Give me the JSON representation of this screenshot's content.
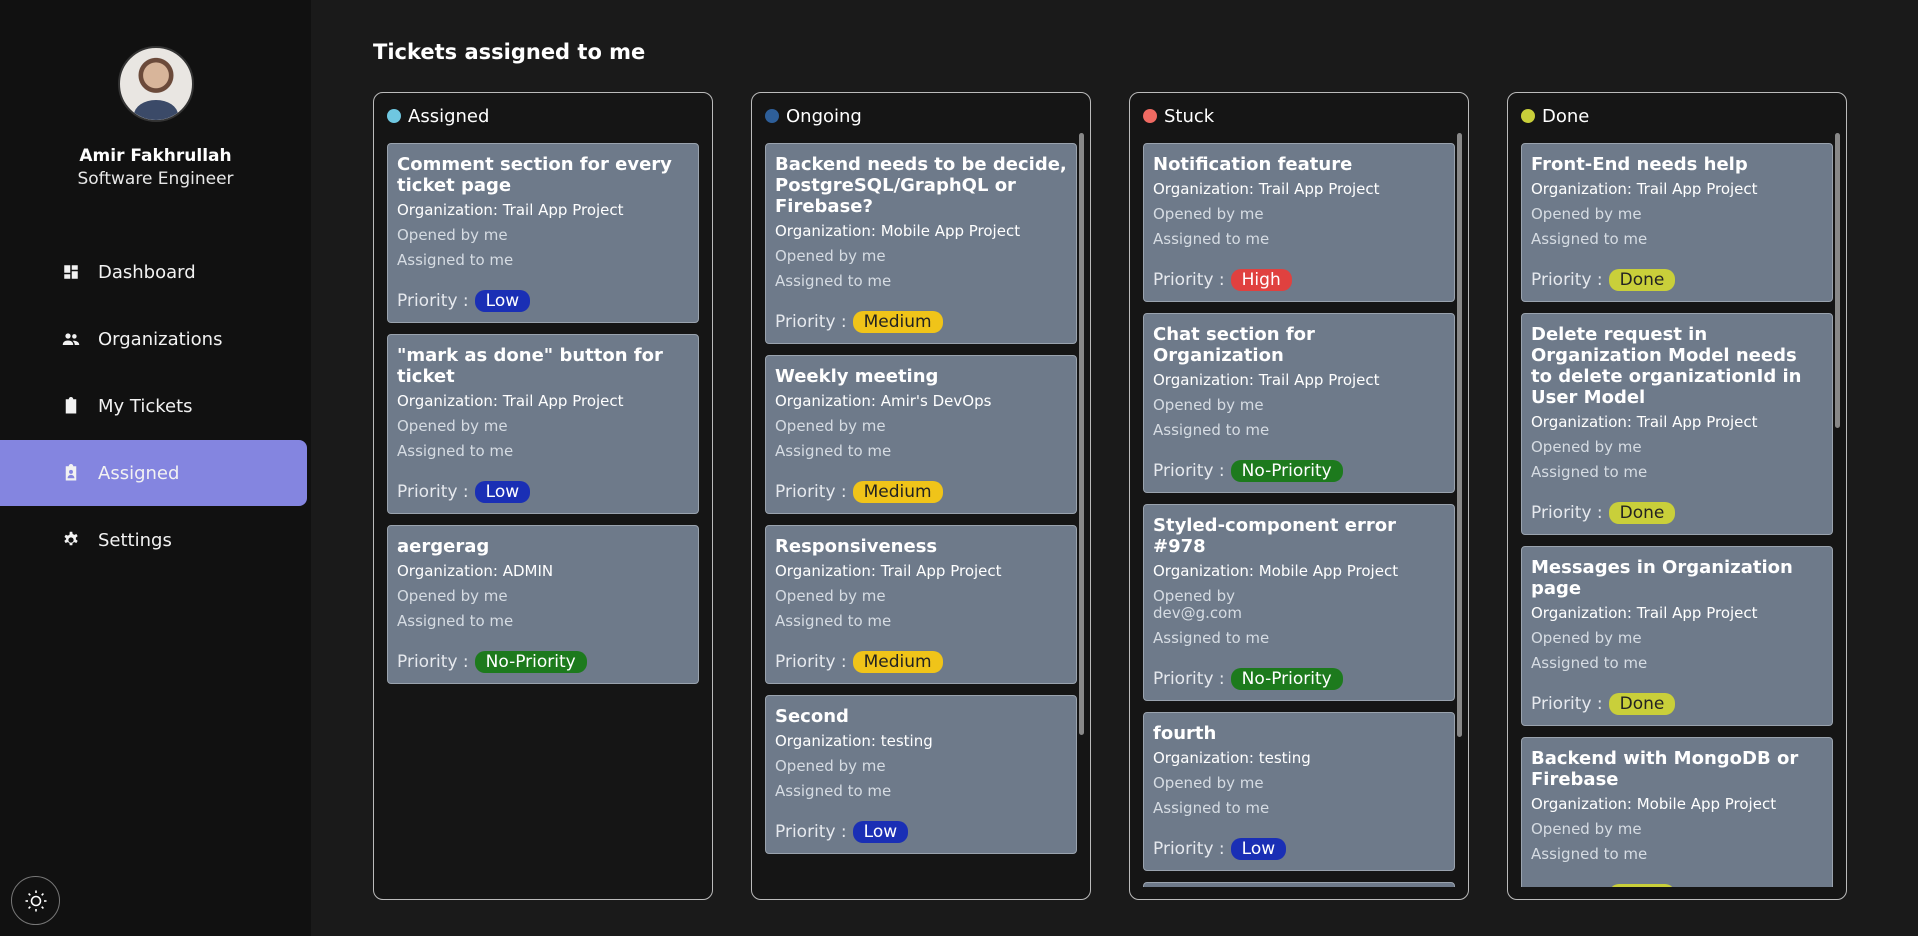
{
  "user": {
    "name": "Amir Fakhrullah",
    "role": "Software Engineer"
  },
  "nav": [
    {
      "label": "Dashboard",
      "icon": "dashboard-icon",
      "active": false
    },
    {
      "label": "Organizations",
      "icon": "people-icon",
      "active": false
    },
    {
      "label": "My Tickets",
      "icon": "clipboard-icon",
      "active": false
    },
    {
      "label": "Assigned",
      "icon": "assigned-clipboard-icon",
      "active": true
    },
    {
      "label": "Settings",
      "icon": "gear-icon",
      "active": false
    }
  ],
  "page_title": "Tickets assigned to me",
  "priority_label": "Priority :",
  "colors": {
    "Low": "#1a2fb5",
    "Medium": "#f0c419",
    "High": "#e0413f",
    "No-Priority": "#1d7a1d",
    "Done": "#c9cf3a"
  },
  "columns": [
    {
      "name": "Assigned",
      "dot": "#6fc7e0",
      "cards": [
        {
          "title": "Comment section for every ticket page",
          "org": "Organization: Trail App Project",
          "opened": "Opened by me",
          "assigned": "Assigned to me",
          "priority": "Low"
        },
        {
          "title": "\"mark as done\" button for ticket",
          "org": "Organization: Trail App Project",
          "opened": "Opened by me",
          "assigned": "Assigned to me",
          "priority": "Low"
        },
        {
          "title": "aergerag",
          "org": "Organization: ADMIN",
          "opened": "Opened by me",
          "assigned": "Assigned to me",
          "priority": "No-Priority"
        }
      ]
    },
    {
      "name": "Ongoing",
      "dot": "#2e5f9a",
      "cards": [
        {
          "title": "Backend needs to be decide, PostgreSQL/GraphQL or Firebase?",
          "org": "Organization: Mobile App Project",
          "opened": "Opened by me",
          "assigned": "Assigned to me",
          "priority": "Medium"
        },
        {
          "title": "Weekly meeting",
          "org": "Organization: Amir's DevOps",
          "opened": "Opened by me",
          "assigned": "Assigned to me",
          "priority": "Medium"
        },
        {
          "title": "Responsiveness",
          "org": "Organization: Trail App Project",
          "opened": "Opened by me",
          "assigned": "Assigned to me",
          "priority": "Medium"
        },
        {
          "title": "Second",
          "org": "Organization: testing",
          "opened": "Opened by me",
          "assigned": "Assigned to me",
          "priority": "Low"
        }
      ]
    },
    {
      "name": "Stuck",
      "dot": "#ef6a62",
      "cards": [
        {
          "title": "Notification feature",
          "org": "Organization: Trail App Project",
          "opened": "Opened by me",
          "assigned": "Assigned to me",
          "priority": "High"
        },
        {
          "title": "Chat section for Organization",
          "org": "Organization: Trail App Project",
          "opened": "Opened by me",
          "assigned": "Assigned to me",
          "priority": "No-Priority"
        },
        {
          "title": "Styled-component error #978",
          "org": "Organization: Mobile App Project",
          "opened": "Opened by\ndev@g.com",
          "assigned": "Assigned to me",
          "priority": "No-Priority"
        },
        {
          "title": "fourth",
          "org": "Organization: testing",
          "opened": "Opened by me",
          "assigned": "Assigned to me",
          "priority": "Low"
        },
        {
          "title": "",
          "org": "",
          "opened": "",
          "assigned": "",
          "priority": ""
        }
      ]
    },
    {
      "name": "Done",
      "dot": "#c9cf3a",
      "cards": [
        {
          "title": "Front-End needs help",
          "org": "Organization: Trail App Project",
          "opened": "Opened by me",
          "assigned": "Assigned to me",
          "priority": "Done"
        },
        {
          "title": "Delete request in Organization Model needs to delete organizationId in User Model",
          "org": "Organization: Trail App Project",
          "opened": "Opened by me",
          "assigned": "Assigned to me",
          "priority": "Done"
        },
        {
          "title": "Messages in Organization page",
          "org": "Organization: Trail App Project",
          "opened": "Opened by me",
          "assigned": "Assigned to me",
          "priority": "Done"
        },
        {
          "title": "Backend with MongoDB or Firebase",
          "org": "Organization: Mobile App Project",
          "opened": "Opened by me",
          "assigned": "Assigned to me",
          "priority": "Done"
        }
      ]
    }
  ]
}
